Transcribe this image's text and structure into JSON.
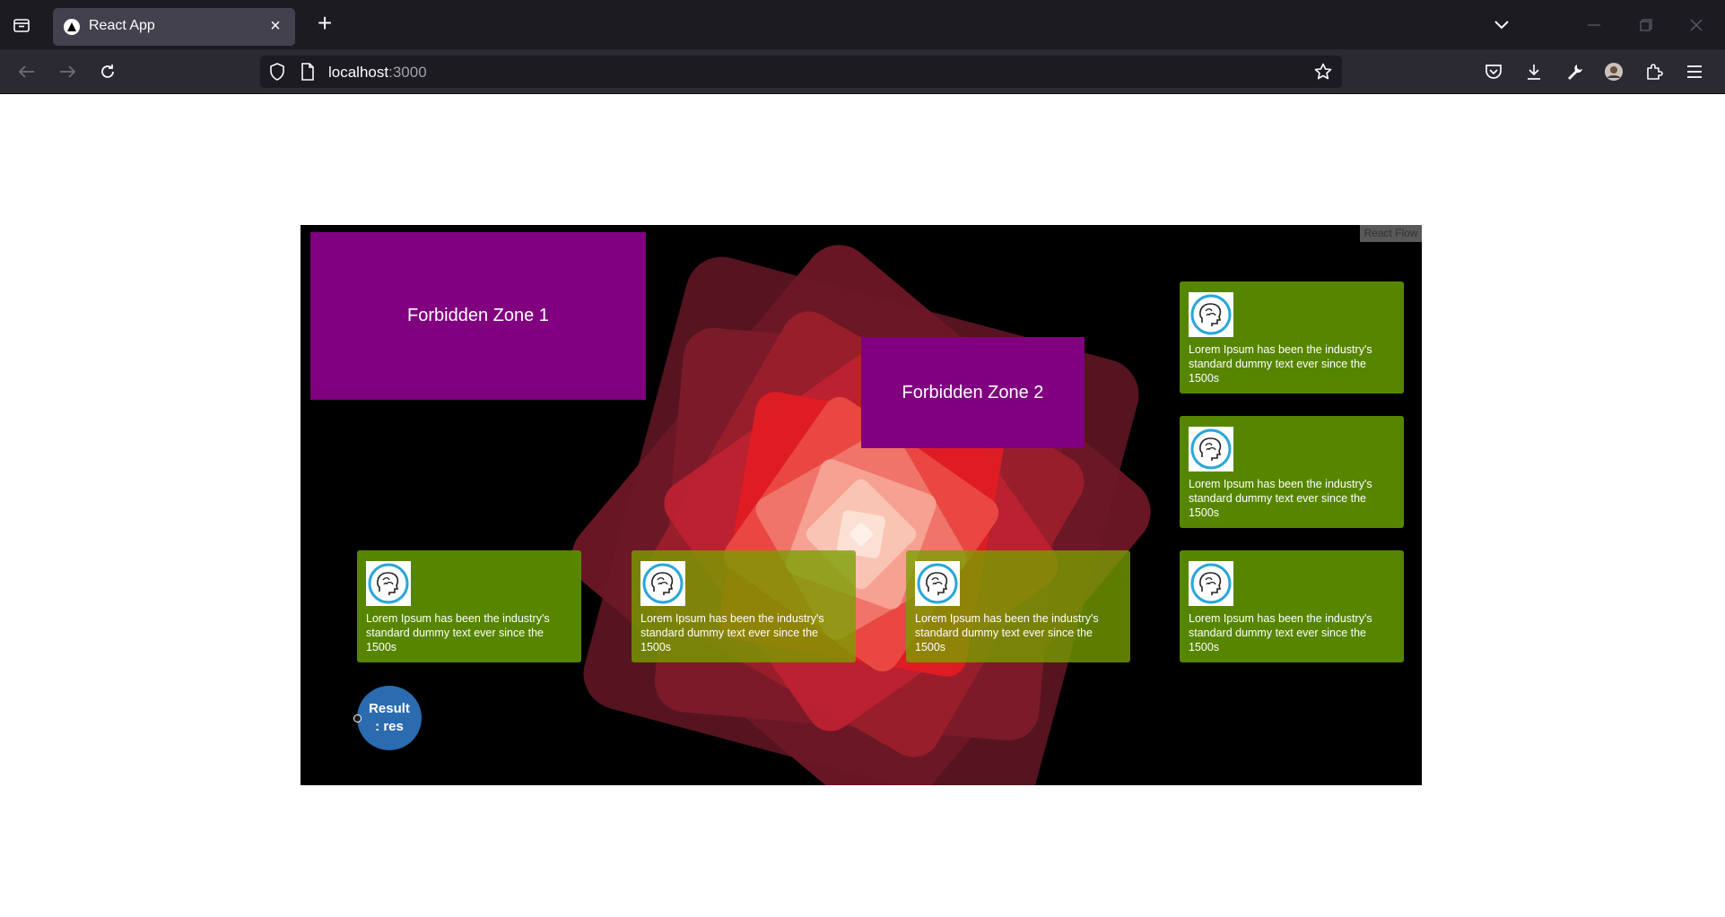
{
  "browser": {
    "tab_title": "React App",
    "url_host": "localhost",
    "url_port": ":3000"
  },
  "flow": {
    "attribution": "React Flow",
    "zones": [
      {
        "label": "Forbidden Zone 1"
      },
      {
        "label": "Forbidden Zone 2"
      }
    ],
    "cards": [
      {
        "text": "Lorem Ipsum has been the industry's standard dummy text ever since the 1500s"
      },
      {
        "text": "Lorem Ipsum has been the industry's standard dummy text ever since the 1500s"
      },
      {
        "text": "Lorem Ipsum has been the industry's standard dummy text ever since the 1500s"
      },
      {
        "text": "Lorem Ipsum has been the industry's standard dummy text ever since the 1500s"
      },
      {
        "text": "Lorem Ipsum has been the industry's standard dummy text ever since the 1500s"
      },
      {
        "text": "Lorem Ipsum has been the industry's standard dummy text ever since the 1500s"
      }
    ],
    "result_node": {
      "label": "Result : res"
    },
    "icon": "brain-head-icon",
    "colors": {
      "zone": "#800080",
      "card": "#598a00",
      "result": "#2b6cb0",
      "canvas": "#000000"
    }
  }
}
